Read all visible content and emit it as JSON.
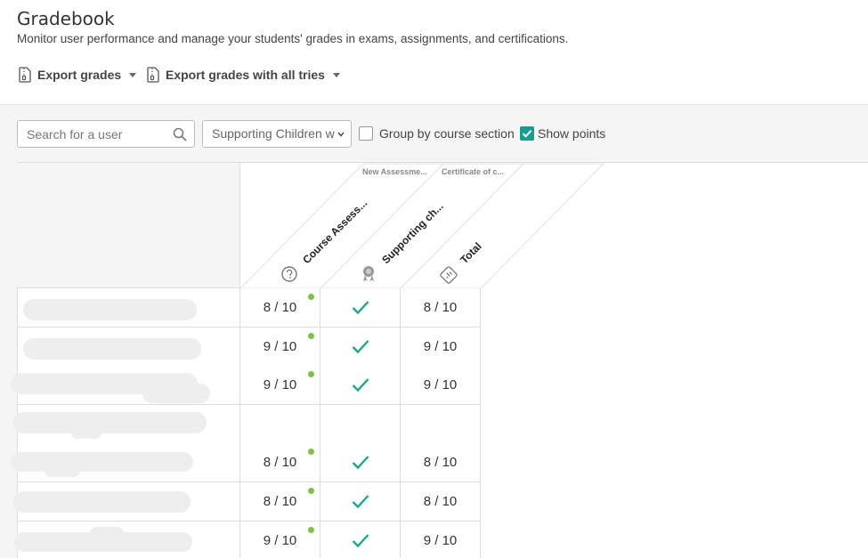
{
  "header": {
    "title": "Gradebook",
    "subtitle": "Monitor user performance and manage your students' grades in exams, assignments, and certifications.",
    "export_grades": "Export grades",
    "export_all_tries": "Export grades with all tries",
    "export_icon": "zip-file-icon"
  },
  "filters": {
    "search_placeholder": "Search for a user",
    "course_select": "Supporting Children w",
    "group_by_label": "Group by course section",
    "group_by_checked": false,
    "show_points_label": "Show points",
    "show_points_checked": true
  },
  "columns": [
    {
      "group": "New Assessme...",
      "label": "Course Assess...",
      "icon": "question-icon"
    },
    {
      "group": "Certificate of c...",
      "label": "Supporting ch...",
      "icon": "certificate-icon"
    },
    {
      "group": "",
      "label": "Total",
      "icon": "total-icon"
    }
  ],
  "rows": [
    {
      "score": "8 / 10",
      "passed": true,
      "total": "8 / 10"
    },
    {
      "score": "9 / 10",
      "passed": true,
      "total": "9 / 10"
    },
    {
      "score": "9 / 10",
      "passed": true,
      "total": "9 / 10"
    },
    {
      "score": "",
      "passed": false,
      "total": ""
    },
    {
      "score": "8 / 10",
      "passed": true,
      "total": "8 / 10"
    },
    {
      "score": "8 / 10",
      "passed": true,
      "total": "8 / 10"
    },
    {
      "score": "9 / 10",
      "passed": true,
      "total": "9 / 10"
    }
  ],
  "colors": {
    "accent": "#1a9b8e",
    "check": "#1aa78a",
    "dot": "#7cc342"
  }
}
